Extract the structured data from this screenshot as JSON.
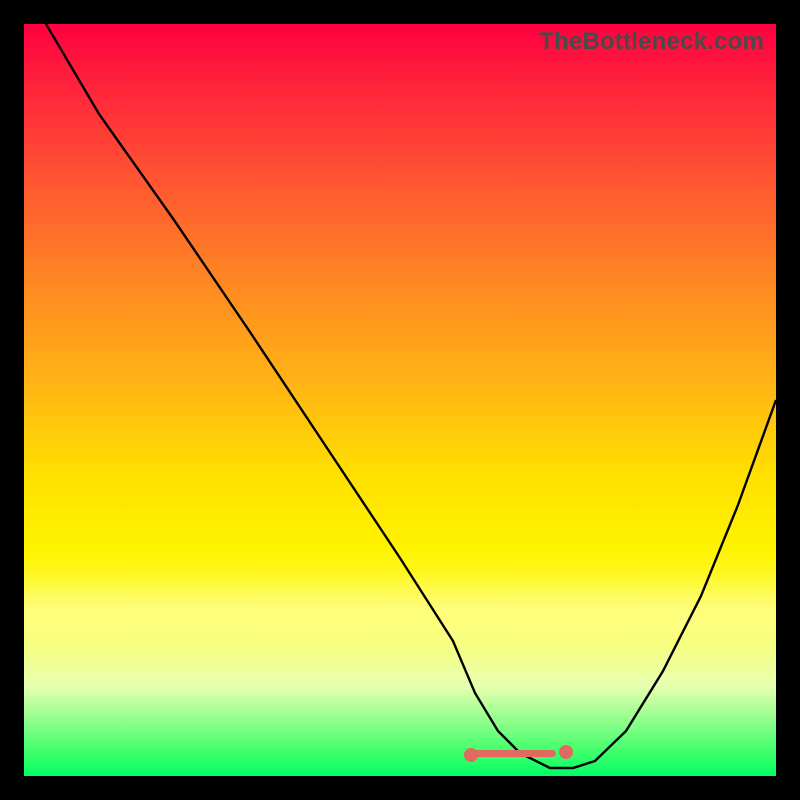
{
  "watermark": "TheBottleneck.com",
  "chart_data": {
    "type": "line",
    "title": "",
    "xlabel": "",
    "ylabel": "",
    "xlim": [
      0,
      100
    ],
    "ylim": [
      0,
      100
    ],
    "grid": false,
    "background": "rainbow-vertical-gradient (red top → green bottom)",
    "series": [
      {
        "name": "bottleneck-curve",
        "x": [
          3,
          10,
          20,
          30,
          40,
          50,
          57,
          60,
          63,
          66,
          70,
          73,
          76,
          80,
          85,
          90,
          95,
          100
        ],
        "values": [
          100,
          88,
          74,
          59,
          44,
          29,
          18,
          11,
          6,
          3,
          1,
          1,
          2,
          6,
          14,
          24,
          36,
          50
        ]
      }
    ],
    "annotations": [
      {
        "name": "optimal-range-marker",
        "shape": "rounded-bar-with-end-dots",
        "color": "#e06a60",
        "x_range": [
          60,
          74
        ],
        "y": 2
      }
    ]
  }
}
